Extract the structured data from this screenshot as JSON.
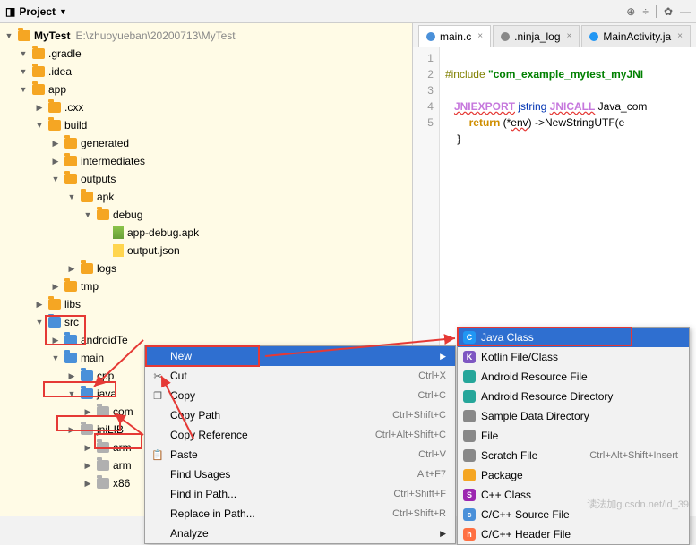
{
  "top": {
    "project_label": "Project",
    "icons": [
      "target",
      "collapse",
      "gear",
      "hide"
    ]
  },
  "project": {
    "name": "MyTest",
    "path": "E:\\zhuoyueban\\20200713\\MyTest"
  },
  "tree": [
    {
      "indent": 0,
      "arrow": "down",
      "icon": "folder",
      "label": ".gradle"
    },
    {
      "indent": 0,
      "arrow": "down",
      "icon": "folder",
      "label": ".idea"
    },
    {
      "indent": 0,
      "arrow": "down",
      "icon": "folder",
      "label": "app"
    },
    {
      "indent": 1,
      "arrow": "right",
      "icon": "folder",
      "label": ".cxx"
    },
    {
      "indent": 1,
      "arrow": "down",
      "icon": "folder",
      "label": "build"
    },
    {
      "indent": 2,
      "arrow": "right",
      "icon": "folder",
      "label": "generated"
    },
    {
      "indent": 2,
      "arrow": "right",
      "icon": "folder",
      "label": "intermediates"
    },
    {
      "indent": 2,
      "arrow": "down",
      "icon": "folder",
      "label": "outputs"
    },
    {
      "indent": 3,
      "arrow": "down",
      "icon": "folder",
      "label": "apk"
    },
    {
      "indent": 4,
      "arrow": "down",
      "icon": "folder",
      "label": "debug"
    },
    {
      "indent": 5,
      "arrow": "none",
      "icon": "apk",
      "label": "app-debug.apk"
    },
    {
      "indent": 5,
      "arrow": "none",
      "icon": "json",
      "label": "output.json"
    },
    {
      "indent": 3,
      "arrow": "right",
      "icon": "folder",
      "label": "logs"
    },
    {
      "indent": 2,
      "arrow": "right",
      "icon": "folder",
      "label": "tmp"
    },
    {
      "indent": 1,
      "arrow": "right",
      "icon": "folder",
      "label": "libs"
    },
    {
      "indent": 1,
      "arrow": "down",
      "icon": "src",
      "label": "src"
    },
    {
      "indent": 2,
      "arrow": "right",
      "icon": "src",
      "label": "androidTe"
    },
    {
      "indent": 2,
      "arrow": "down",
      "icon": "src",
      "label": "main"
    },
    {
      "indent": 3,
      "arrow": "right",
      "icon": "src",
      "label": "cpp"
    },
    {
      "indent": 3,
      "arrow": "down",
      "icon": "src",
      "label": "java"
    },
    {
      "indent": 4,
      "arrow": "right",
      "icon": "gray",
      "label": "com"
    },
    {
      "indent": 3,
      "arrow": "right",
      "icon": "gray",
      "label": "jniLIB"
    },
    {
      "indent": 4,
      "arrow": "right",
      "icon": "gray",
      "label": "arm"
    },
    {
      "indent": 4,
      "arrow": "right",
      "icon": "gray",
      "label": "arm"
    },
    {
      "indent": 4,
      "arrow": "right",
      "icon": "gray",
      "label": "x86"
    }
  ],
  "tabs": [
    {
      "label": "main.c",
      "active": true,
      "color": "#4a90d9"
    },
    {
      "label": ".ninja_log",
      "active": false,
      "color": "#888"
    },
    {
      "label": "MainActivity.ja",
      "active": false,
      "color": "#2196f3"
    }
  ],
  "code": {
    "lines": [
      "1",
      "2",
      "3",
      "4",
      "5"
    ],
    "l1_pre": "#include ",
    "l1_str": "\"com_example_mytest_myJNI",
    "l2": "",
    "l3_a": "JNIEXPORT",
    "l3_b": " jstring ",
    "l3_c": "JNICALL",
    "l3_d": " Java_com",
    "l4_a": "        ",
    "l4_ret": "return",
    "l4_b": " (*",
    "l4_env": "env",
    "l4_c": ") ->NewStringUTF(e",
    "l5": "    }"
  },
  "ctx": [
    {
      "label": "New",
      "icon": "",
      "shortcut": "",
      "arrow": true,
      "hi": true
    },
    {
      "label": "Cut",
      "icon": "✂",
      "shortcut": "Ctrl+X"
    },
    {
      "label": "Copy",
      "icon": "❐",
      "shortcut": "Ctrl+C"
    },
    {
      "label": "Copy Path",
      "icon": "",
      "shortcut": "Ctrl+Shift+C"
    },
    {
      "label": "Copy Reference",
      "icon": "",
      "shortcut": "Ctrl+Alt+Shift+C"
    },
    {
      "label": "Paste",
      "icon": "📋",
      "shortcut": "Ctrl+V"
    },
    {
      "label": "Find Usages",
      "icon": "",
      "shortcut": "Alt+F7"
    },
    {
      "label": "Find in Path...",
      "icon": "",
      "shortcut": "Ctrl+Shift+F"
    },
    {
      "label": "Replace in Path...",
      "icon": "",
      "shortcut": "Ctrl+Shift+R"
    },
    {
      "label": "Analyze",
      "icon": "",
      "shortcut": "",
      "arrow": true
    }
  ],
  "sub": [
    {
      "label": "Java Class",
      "color": "#2196f3",
      "glyph": "C",
      "hi": true
    },
    {
      "label": "Kotlin File/Class",
      "color": "#7e57c2",
      "glyph": "K"
    },
    {
      "label": "Android Resource File",
      "color": "#26a69a",
      "glyph": ""
    },
    {
      "label": "Android Resource Directory",
      "color": "#26a69a",
      "glyph": ""
    },
    {
      "label": "Sample Data Directory",
      "color": "#888",
      "glyph": ""
    },
    {
      "label": "File",
      "color": "#888",
      "glyph": ""
    },
    {
      "label": "Scratch File",
      "color": "#888",
      "glyph": "",
      "shortcut": "Ctrl+Alt+Shift+Insert"
    },
    {
      "label": "Package",
      "color": "#f5a623",
      "glyph": ""
    },
    {
      "label": "C++ Class",
      "color": "#9c27b0",
      "glyph": "S"
    },
    {
      "label": "C/C++ Source File",
      "color": "#4a90d9",
      "glyph": "c"
    },
    {
      "label": "C/C++ Header File",
      "color": "#ff7043",
      "glyph": "h"
    }
  ],
  "watermark": "读法加g.csdn.net/ld_39"
}
